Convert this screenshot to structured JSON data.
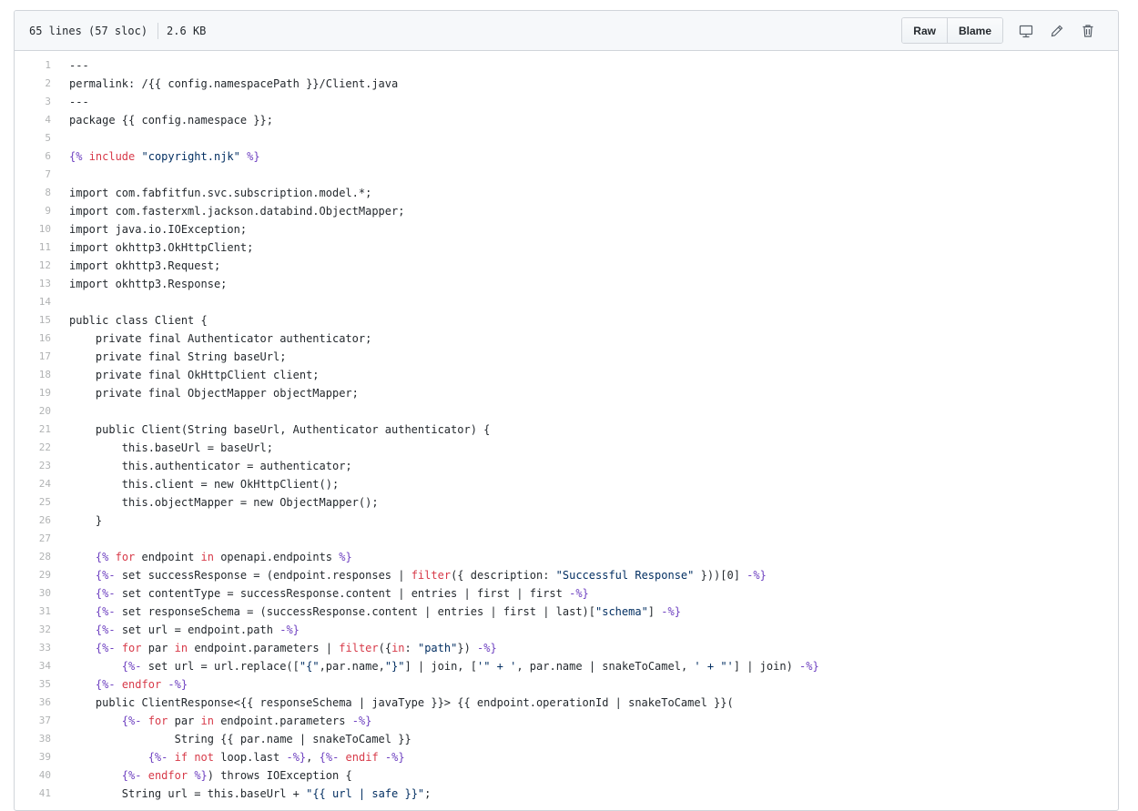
{
  "file_header": {
    "lines_info": "65 lines (57 sloc)",
    "size": "2.6 KB",
    "raw_label": "Raw",
    "blame_label": "Blame",
    "icons": [
      "desktop-icon",
      "pencil-icon",
      "trash-icon"
    ]
  },
  "colors": {
    "delimiter": "#6f42c1",
    "keyword": "#d73a49",
    "string": "#032f62",
    "line_number": "#bbbbbb"
  },
  "code_lines": [
    {
      "num": "1",
      "tokens": [
        {
          "t": "---",
          "c": ""
        }
      ]
    },
    {
      "num": "2",
      "tokens": [
        {
          "t": "permalink: /{{ config.namespacePath }}/Client.java",
          "c": ""
        }
      ]
    },
    {
      "num": "3",
      "tokens": [
        {
          "t": "---",
          "c": ""
        }
      ]
    },
    {
      "num": "4",
      "tokens": [
        {
          "t": "package {{ config.namespace }};",
          "c": ""
        }
      ]
    },
    {
      "num": "5",
      "tokens": []
    },
    {
      "num": "6",
      "tokens": [
        {
          "t": "{%",
          "c": "d"
        },
        {
          "t": " ",
          "c": ""
        },
        {
          "t": "include",
          "c": "k"
        },
        {
          "t": " ",
          "c": ""
        },
        {
          "t": "\"copyright.njk\"",
          "c": "s"
        },
        {
          "t": " ",
          "c": ""
        },
        {
          "t": "%}",
          "c": "d"
        }
      ]
    },
    {
      "num": "7",
      "tokens": []
    },
    {
      "num": "8",
      "tokens": [
        {
          "t": "import com.fabfitfun.svc.subscription.model.*;",
          "c": ""
        }
      ]
    },
    {
      "num": "9",
      "tokens": [
        {
          "t": "import com.fasterxml.jackson.databind.ObjectMapper;",
          "c": ""
        }
      ]
    },
    {
      "num": "10",
      "tokens": [
        {
          "t": "import java.io.IOException;",
          "c": ""
        }
      ]
    },
    {
      "num": "11",
      "tokens": [
        {
          "t": "import okhttp3.OkHttpClient;",
          "c": ""
        }
      ]
    },
    {
      "num": "12",
      "tokens": [
        {
          "t": "import okhttp3.Request;",
          "c": ""
        }
      ]
    },
    {
      "num": "13",
      "tokens": [
        {
          "t": "import okhttp3.Response;",
          "c": ""
        }
      ]
    },
    {
      "num": "14",
      "tokens": []
    },
    {
      "num": "15",
      "tokens": [
        {
          "t": "public class Client {",
          "c": ""
        }
      ]
    },
    {
      "num": "16",
      "tokens": [
        {
          "t": "    private final Authenticator authenticator;",
          "c": ""
        }
      ]
    },
    {
      "num": "17",
      "tokens": [
        {
          "t": "    private final String baseUrl;",
          "c": ""
        }
      ]
    },
    {
      "num": "18",
      "tokens": [
        {
          "t": "    private final OkHttpClient client;",
          "c": ""
        }
      ]
    },
    {
      "num": "19",
      "tokens": [
        {
          "t": "    private final ObjectMapper objectMapper;",
          "c": ""
        }
      ]
    },
    {
      "num": "20",
      "tokens": []
    },
    {
      "num": "21",
      "tokens": [
        {
          "t": "    public Client(String baseUrl, Authenticator authenticator) {",
          "c": ""
        }
      ]
    },
    {
      "num": "22",
      "tokens": [
        {
          "t": "        this.baseUrl = baseUrl;",
          "c": ""
        }
      ]
    },
    {
      "num": "23",
      "tokens": [
        {
          "t": "        this.authenticator = authenticator;",
          "c": ""
        }
      ]
    },
    {
      "num": "24",
      "tokens": [
        {
          "t": "        this.client = new OkHttpClient();",
          "c": ""
        }
      ]
    },
    {
      "num": "25",
      "tokens": [
        {
          "t": "        this.objectMapper = new ObjectMapper();",
          "c": ""
        }
      ]
    },
    {
      "num": "26",
      "tokens": [
        {
          "t": "    }",
          "c": ""
        }
      ]
    },
    {
      "num": "27",
      "tokens": []
    },
    {
      "num": "28",
      "tokens": [
        {
          "t": "    ",
          "c": ""
        },
        {
          "t": "{%",
          "c": "d"
        },
        {
          "t": " ",
          "c": ""
        },
        {
          "t": "for",
          "c": "k"
        },
        {
          "t": " endpoint ",
          "c": ""
        },
        {
          "t": "in",
          "c": "k"
        },
        {
          "t": " openapi.endpoints ",
          "c": ""
        },
        {
          "t": "%}",
          "c": "d"
        }
      ]
    },
    {
      "num": "29",
      "tokens": [
        {
          "t": "    ",
          "c": ""
        },
        {
          "t": "{%-",
          "c": "d"
        },
        {
          "t": " set successResponse = (endpoint.responses | ",
          "c": ""
        },
        {
          "t": "filter",
          "c": "k"
        },
        {
          "t": "({ description: ",
          "c": ""
        },
        {
          "t": "\"Successful Response\"",
          "c": "s"
        },
        {
          "t": " }))[0] ",
          "c": ""
        },
        {
          "t": "-%}",
          "c": "d"
        }
      ]
    },
    {
      "num": "30",
      "tokens": [
        {
          "t": "    ",
          "c": ""
        },
        {
          "t": "{%-",
          "c": "d"
        },
        {
          "t": " set contentType = successResponse.content | entries | first | first ",
          "c": ""
        },
        {
          "t": "-%}",
          "c": "d"
        }
      ]
    },
    {
      "num": "31",
      "tokens": [
        {
          "t": "    ",
          "c": ""
        },
        {
          "t": "{%-",
          "c": "d"
        },
        {
          "t": " set responseSchema = (successResponse.content | entries | first | last)[",
          "c": ""
        },
        {
          "t": "\"schema\"",
          "c": "s"
        },
        {
          "t": "] ",
          "c": ""
        },
        {
          "t": "-%}",
          "c": "d"
        }
      ]
    },
    {
      "num": "32",
      "tokens": [
        {
          "t": "    ",
          "c": ""
        },
        {
          "t": "{%-",
          "c": "d"
        },
        {
          "t": " set url = endpoint.path ",
          "c": ""
        },
        {
          "t": "-%}",
          "c": "d"
        }
      ]
    },
    {
      "num": "33",
      "tokens": [
        {
          "t": "    ",
          "c": ""
        },
        {
          "t": "{%-",
          "c": "d"
        },
        {
          "t": " ",
          "c": ""
        },
        {
          "t": "for",
          "c": "k"
        },
        {
          "t": " par ",
          "c": ""
        },
        {
          "t": "in",
          "c": "k"
        },
        {
          "t": " endpoint.parameters | ",
          "c": ""
        },
        {
          "t": "filter",
          "c": "k"
        },
        {
          "t": "({",
          "c": ""
        },
        {
          "t": "in",
          "c": "k"
        },
        {
          "t": ": ",
          "c": ""
        },
        {
          "t": "\"path\"",
          "c": "s"
        },
        {
          "t": "}) ",
          "c": ""
        },
        {
          "t": "-%}",
          "c": "d"
        }
      ]
    },
    {
      "num": "34",
      "tokens": [
        {
          "t": "        ",
          "c": ""
        },
        {
          "t": "{%-",
          "c": "d"
        },
        {
          "t": " set url = url.replace([",
          "c": ""
        },
        {
          "t": "\"{\"",
          "c": "s"
        },
        {
          "t": ",par.name,",
          "c": ""
        },
        {
          "t": "\"}\"",
          "c": "s"
        },
        {
          "t": "] | join, [",
          "c": ""
        },
        {
          "t": "'\" + '",
          "c": "s"
        },
        {
          "t": ", par.name | snakeToCamel, ",
          "c": ""
        },
        {
          "t": "' + \"'",
          "c": "s"
        },
        {
          "t": "] | join) ",
          "c": ""
        },
        {
          "t": "-%}",
          "c": "d"
        }
      ]
    },
    {
      "num": "35",
      "tokens": [
        {
          "t": "    ",
          "c": ""
        },
        {
          "t": "{%-",
          "c": "d"
        },
        {
          "t": " ",
          "c": ""
        },
        {
          "t": "endfor",
          "c": "k"
        },
        {
          "t": " ",
          "c": ""
        },
        {
          "t": "-%}",
          "c": "d"
        }
      ]
    },
    {
      "num": "36",
      "tokens": [
        {
          "t": "    public ClientResponse<{{ responseSchema | javaType }}> {{ endpoint.operationId | snakeToCamel }}(",
          "c": ""
        }
      ]
    },
    {
      "num": "37",
      "tokens": [
        {
          "t": "        ",
          "c": ""
        },
        {
          "t": "{%-",
          "c": "d"
        },
        {
          "t": " ",
          "c": ""
        },
        {
          "t": "for",
          "c": "k"
        },
        {
          "t": " par ",
          "c": ""
        },
        {
          "t": "in",
          "c": "k"
        },
        {
          "t": " endpoint.parameters ",
          "c": ""
        },
        {
          "t": "-%}",
          "c": "d"
        }
      ]
    },
    {
      "num": "38",
      "tokens": [
        {
          "t": "                String {{ par.name | snakeToCamel }}",
          "c": ""
        }
      ]
    },
    {
      "num": "39",
      "tokens": [
        {
          "t": "            ",
          "c": ""
        },
        {
          "t": "{%-",
          "c": "d"
        },
        {
          "t": " ",
          "c": ""
        },
        {
          "t": "if",
          "c": "k"
        },
        {
          "t": " ",
          "c": ""
        },
        {
          "t": "not",
          "c": "k"
        },
        {
          "t": " loop.last ",
          "c": ""
        },
        {
          "t": "-%}",
          "c": "d"
        },
        {
          "t": ", ",
          "c": ""
        },
        {
          "t": "{%-",
          "c": "d"
        },
        {
          "t": " ",
          "c": ""
        },
        {
          "t": "endif",
          "c": "k"
        },
        {
          "t": " ",
          "c": ""
        },
        {
          "t": "-%}",
          "c": "d"
        }
      ]
    },
    {
      "num": "40",
      "tokens": [
        {
          "t": "        ",
          "c": ""
        },
        {
          "t": "{%-",
          "c": "d"
        },
        {
          "t": " ",
          "c": ""
        },
        {
          "t": "endfor",
          "c": "k"
        },
        {
          "t": " ",
          "c": ""
        },
        {
          "t": "%}",
          "c": "d"
        },
        {
          "t": ") throws IOException {",
          "c": ""
        }
      ]
    },
    {
      "num": "41",
      "tokens": [
        {
          "t": "        String url = this.baseUrl + ",
          "c": ""
        },
        {
          "t": "\"{{ url | safe }}\"",
          "c": "s"
        },
        {
          "t": ";",
          "c": ""
        }
      ]
    }
  ]
}
